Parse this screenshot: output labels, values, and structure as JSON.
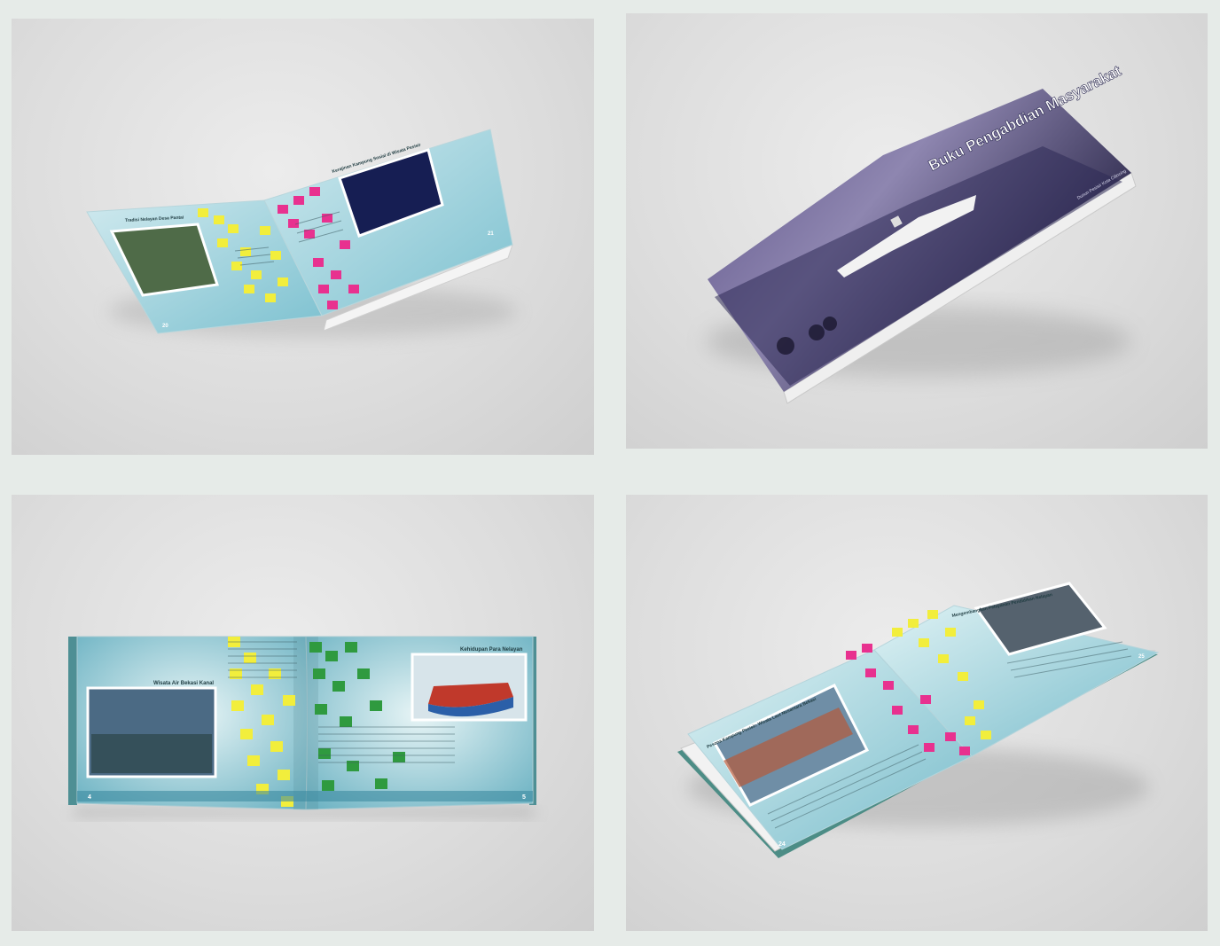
{
  "panels": [
    {
      "id": "open-book-tilted",
      "left_page": {
        "title": "Tradisi Nelayan Desa Pantai",
        "page_number": "20"
      },
      "right_page": {
        "title": "Kerajinan Kampung Sosial di Wisata Pesisir",
        "page_number": "21"
      },
      "accent_colors": [
        "#f2ee3c",
        "#e8318f"
      ]
    },
    {
      "id": "closed-book-cover",
      "cover": {
        "title": "Buku Pengabdian Masyarakat",
        "credit": "Dusun Pesisir Kota Cilincing"
      }
    },
    {
      "id": "open-book-flat",
      "left_page": {
        "title": "Wisata Air Bekasi Kanal",
        "page_number": "4"
      },
      "right_page": {
        "title": "Kehidupan Para Nelayan",
        "page_number": "5"
      },
      "accent_colors": [
        "#f2ee3c",
        "#2f9a3f"
      ]
    },
    {
      "id": "open-book-angled",
      "left_page": {
        "title": "Pesona Kampung Pesisir: Wisata Laut Nusantara Bekasi",
        "page_number": "24"
      },
      "right_page": {
        "title": "Mengembangkan Pelayanan Pendidikan Nelayan",
        "page_number": "25"
      },
      "accent_colors": [
        "#e8318f",
        "#f2ee3c"
      ]
    }
  ]
}
